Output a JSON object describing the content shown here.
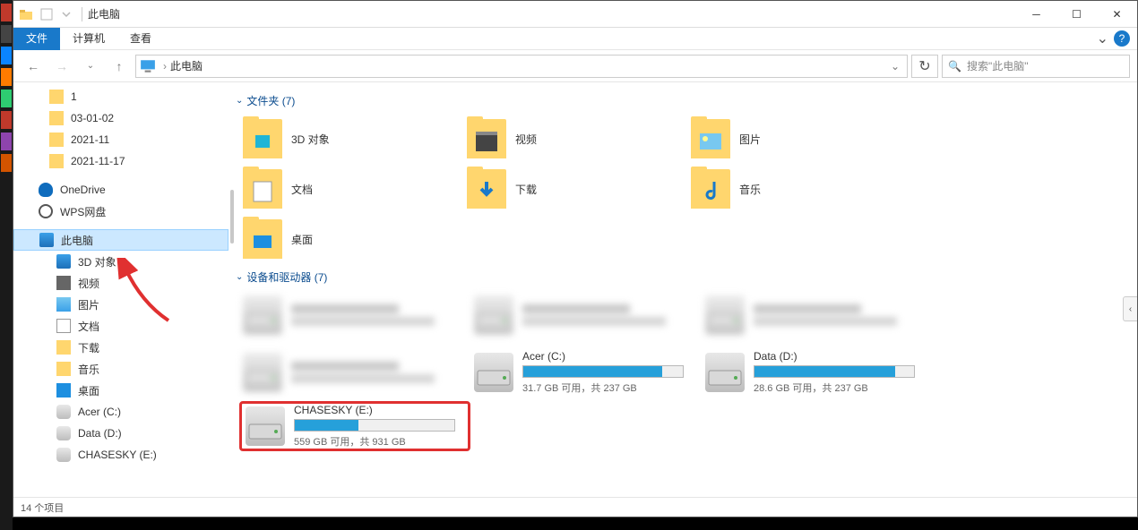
{
  "window": {
    "title": "此电脑"
  },
  "ribbon": {
    "file": "文件",
    "computer": "计算机",
    "view": "查看"
  },
  "address": {
    "crumb": "此电脑"
  },
  "search": {
    "placeholder": "搜索\"此电脑\""
  },
  "nav": {
    "quick": [
      {
        "label": "1",
        "icon": "folder"
      },
      {
        "label": "03-01-02",
        "icon": "folder"
      },
      {
        "label": "2021-11",
        "icon": "folder"
      },
      {
        "label": "2021-11-17",
        "icon": "folder"
      }
    ],
    "cloud": [
      {
        "label": "OneDrive",
        "icon": "onedrive"
      },
      {
        "label": "WPS网盘",
        "icon": "cloud"
      }
    ],
    "thispc_label": "此电脑",
    "thispc_children": [
      {
        "label": "3D 对象",
        "icon": "cube"
      },
      {
        "label": "视频",
        "icon": "video"
      },
      {
        "label": "图片",
        "icon": "pic"
      },
      {
        "label": "文档",
        "icon": "doc"
      },
      {
        "label": "下载",
        "icon": "down"
      },
      {
        "label": "音乐",
        "icon": "music"
      },
      {
        "label": "桌面",
        "icon": "desktop"
      },
      {
        "label": "Acer (C:)",
        "icon": "drive"
      },
      {
        "label": "Data (D:)",
        "icon": "drive"
      },
      {
        "label": "CHASESKY (E:)",
        "icon": "drive"
      }
    ]
  },
  "sections": {
    "folders_header": "文件夹 (7)",
    "devices_header": "设备和驱动器 (7)"
  },
  "folders": [
    {
      "label": "3D 对象"
    },
    {
      "label": "视频"
    },
    {
      "label": "图片"
    },
    {
      "label": "文档"
    },
    {
      "label": "下载"
    },
    {
      "label": "音乐"
    },
    {
      "label": "桌面"
    }
  ],
  "devices": [
    {
      "name": "",
      "avail": "",
      "blurred": true
    },
    {
      "name": "",
      "avail": "",
      "blurred": true
    },
    {
      "name": "",
      "avail": "",
      "blurred": true
    },
    {
      "name": "",
      "avail": "",
      "blurred": true
    },
    {
      "name": "Acer (C:)",
      "avail": "31.7 GB 可用，共 237 GB",
      "used_pct": 87
    },
    {
      "name": "Data (D:)",
      "avail": "28.6 GB 可用，共 237 GB",
      "used_pct": 88
    },
    {
      "name": "CHASESKY (E:)",
      "avail": "559 GB 可用，共 931 GB",
      "used_pct": 40,
      "highlighted": true
    }
  ],
  "statusbar": {
    "items": "14 个项目"
  }
}
